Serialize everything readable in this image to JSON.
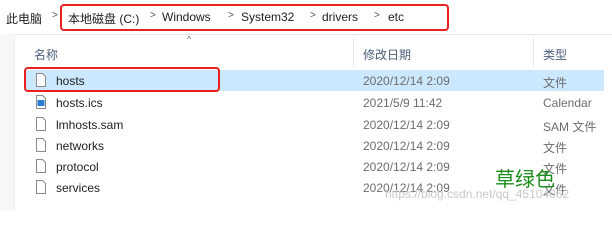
{
  "address_bar": {
    "root": "此电脑",
    "crumbs": [
      "本地磁盘 (C:)",
      "Windows",
      "System32",
      "drivers",
      "etc"
    ],
    "separator": ">"
  },
  "columns": {
    "name": "名称",
    "date_modified": "修改日期",
    "type": "类型"
  },
  "files": [
    {
      "name": "hosts",
      "date": "2020/12/14 2:09",
      "type": "文件",
      "icon": "file-icon",
      "selected": true
    },
    {
      "name": "hosts.ics",
      "date": "2021/5/9 11:42",
      "type": "Calendar",
      "icon": "calendar-file-icon",
      "selected": false
    },
    {
      "name": "lmhosts.sam",
      "date": "2020/12/14 2:09",
      "type": "SAM 文件",
      "icon": "file-icon",
      "selected": false
    },
    {
      "name": "networks",
      "date": "2020/12/14 2:09",
      "type": "文件",
      "icon": "file-icon",
      "selected": false
    },
    {
      "name": "protocol",
      "date": "2020/12/14 2:09",
      "type": "文件",
      "icon": "file-icon",
      "selected": false
    },
    {
      "name": "services",
      "date": "2020/12/14 2:09",
      "type": "文件",
      "icon": "file-icon",
      "selected": false
    }
  ],
  "annotation": "草绿色",
  "watermark": "https://blog.csdn.net/qq_45104062",
  "colors": {
    "selection": "#cce8ff",
    "highlight_box": "#e82020",
    "annotation": "#1a8c1a"
  }
}
